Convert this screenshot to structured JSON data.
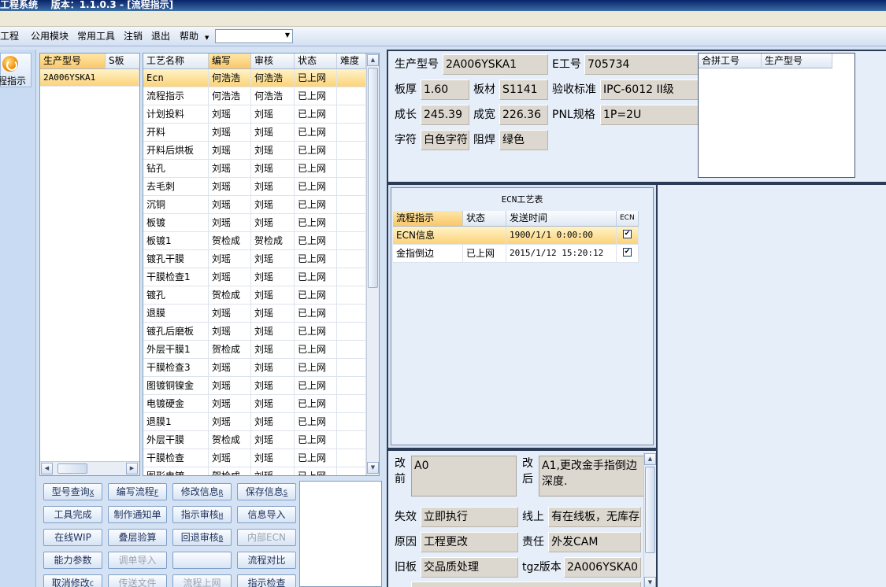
{
  "window": {
    "title": "工程系统    版本：1.1.0.3 - [流程指示]"
  },
  "menu": {
    "items": [
      "工程",
      "公用模块",
      "常用工具",
      "注销",
      "退出",
      "帮助"
    ],
    "help_arrow": "▼"
  },
  "nav": {
    "label": "程指示"
  },
  "model_list": {
    "columns": [
      "生产型号",
      "S板"
    ],
    "rows": [
      [
        "2A006YSKA1",
        ""
      ]
    ]
  },
  "process_grid": {
    "columns": [
      "工艺名称",
      "编写",
      "审核",
      "状态",
      "难度"
    ],
    "rows": [
      [
        "Ecn",
        "何浩浩",
        "何浩浩",
        "已上网",
        ""
      ],
      [
        "流程指示",
        "何浩浩",
        "何浩浩",
        "已上网",
        ""
      ],
      [
        "计划投料",
        "刘瑶",
        "刘瑶",
        "已上网",
        ""
      ],
      [
        "开料",
        "刘瑶",
        "刘瑶",
        "已上网",
        ""
      ],
      [
        "开料后烘板",
        "刘瑶",
        "刘瑶",
        "已上网",
        ""
      ],
      [
        "钻孔",
        "刘瑶",
        "刘瑶",
        "已上网",
        ""
      ],
      [
        "去毛刺",
        "刘瑶",
        "刘瑶",
        "已上网",
        ""
      ],
      [
        "沉铜",
        "刘瑶",
        "刘瑶",
        "已上网",
        ""
      ],
      [
        "板镀",
        "刘瑶",
        "刘瑶",
        "已上网",
        ""
      ],
      [
        "板镀1",
        "贺检成",
        "贺检成",
        "已上网",
        ""
      ],
      [
        "镀孔干膜",
        "刘瑶",
        "刘瑶",
        "已上网",
        ""
      ],
      [
        "干膜检查1",
        "刘瑶",
        "刘瑶",
        "已上网",
        ""
      ],
      [
        "镀孔",
        "贺检成",
        "刘瑶",
        "已上网",
        ""
      ],
      [
        "退膜",
        "刘瑶",
        "刘瑶",
        "已上网",
        ""
      ],
      [
        "镀孔后磨板",
        "刘瑶",
        "刘瑶",
        "已上网",
        ""
      ],
      [
        "外层干膜1",
        "贺检成",
        "刘瑶",
        "已上网",
        ""
      ],
      [
        "干膜检查3",
        "刘瑶",
        "刘瑶",
        "已上网",
        ""
      ],
      [
        "图镀铜镍金",
        "刘瑶",
        "刘瑶",
        "已上网",
        ""
      ],
      [
        "电镀硬金",
        "刘瑶",
        "刘瑶",
        "已上网",
        ""
      ],
      [
        "退膜1",
        "刘瑶",
        "刘瑶",
        "已上网",
        ""
      ],
      [
        "外层干膜",
        "贺检成",
        "刘瑶",
        "已上网",
        ""
      ],
      [
        "干膜检查",
        "刘瑶",
        "刘瑶",
        "已上网",
        ""
      ],
      [
        "图形电镀",
        "贺检成",
        "刘瑶",
        "已上网",
        ""
      ]
    ]
  },
  "buttons": {
    "row1": [
      {
        "label": "型号查询",
        "key": "X"
      },
      {
        "label": "编写流程",
        "key": "F"
      },
      {
        "label": "修改信息",
        "key": "R"
      },
      {
        "label": "保存信息",
        "key": "S"
      }
    ],
    "row2": [
      {
        "label": "工具完成",
        "key": ""
      },
      {
        "label": "制作通知单",
        "key": ""
      },
      {
        "label": "指示审核",
        "key": "H"
      },
      {
        "label": "信息导入",
        "key": ""
      }
    ],
    "row3": [
      {
        "label": "在线WIP",
        "key": ""
      },
      {
        "label": "叠层验算",
        "key": ""
      },
      {
        "label": "回退审核",
        "key": "B"
      },
      {
        "label": "内部ECN",
        "key": ""
      }
    ],
    "row4": [
      {
        "label": "能力参数",
        "key": ""
      },
      {
        "label": "调单导入",
        "key": ""
      },
      {
        "label": "",
        "key": ""
      },
      {
        "label": "流程对比",
        "key": ""
      }
    ],
    "row5": [
      {
        "label": "取消修改",
        "key": "C"
      },
      {
        "label": "传送文件",
        "key": ""
      },
      {
        "label": "流程上网",
        "key": ""
      },
      {
        "label": "指示检查",
        "key": ""
      }
    ]
  },
  "info": {
    "prod_model_label": "生产型号",
    "prod_model": "2A006YSKA1",
    "eno_label": "E工号",
    "eno": "705734",
    "thickness_label": "板厚",
    "thickness": "1.60",
    "material_label": "板材",
    "material": "S1141",
    "standard_label": "验收标准",
    "standard": "IPC-6012 II级",
    "length_label": "成长",
    "length": "245.39",
    "width_label": "成宽",
    "width": "226.36",
    "pnl_label": "PNL规格",
    "pnl": "1P=2U",
    "char_label": "字符",
    "char": "白色字符",
    "mask_label": "阻焊",
    "mask": "绿色"
  },
  "merge_table": {
    "columns": [
      "合拼工号",
      "生产型号"
    ]
  },
  "ecn": {
    "title": "ECN工艺表",
    "columns": [
      "流程指示",
      "状态",
      "发送时间",
      "ECN"
    ],
    "rows": [
      {
        "flow": "ECN信息",
        "status": "",
        "time": "1900/1/1 0:00:00",
        "checked": "✔"
      },
      {
        "flow": "金指倒边",
        "status": "已上网",
        "time": "2015/1/12 15:20:12",
        "checked": "✔"
      }
    ]
  },
  "change": {
    "before_label_1": "改",
    "before_label_2": "前",
    "before": "A0",
    "after_label_1": "改",
    "after_label_2": "后",
    "after": "A1,更改金手指倒边深度.",
    "invalid_label": "失效",
    "invalid": "立即执行",
    "online_label": "线上",
    "online": "有在线板，无库存",
    "reason_label": "原因",
    "reason": "工程更改",
    "duty_label": "责任",
    "duty": "外发CAM",
    "old_label": "旧板",
    "old": "交品质处理",
    "tgz_label": "tgz版本",
    "tgz": "2A006YSKA0"
  }
}
